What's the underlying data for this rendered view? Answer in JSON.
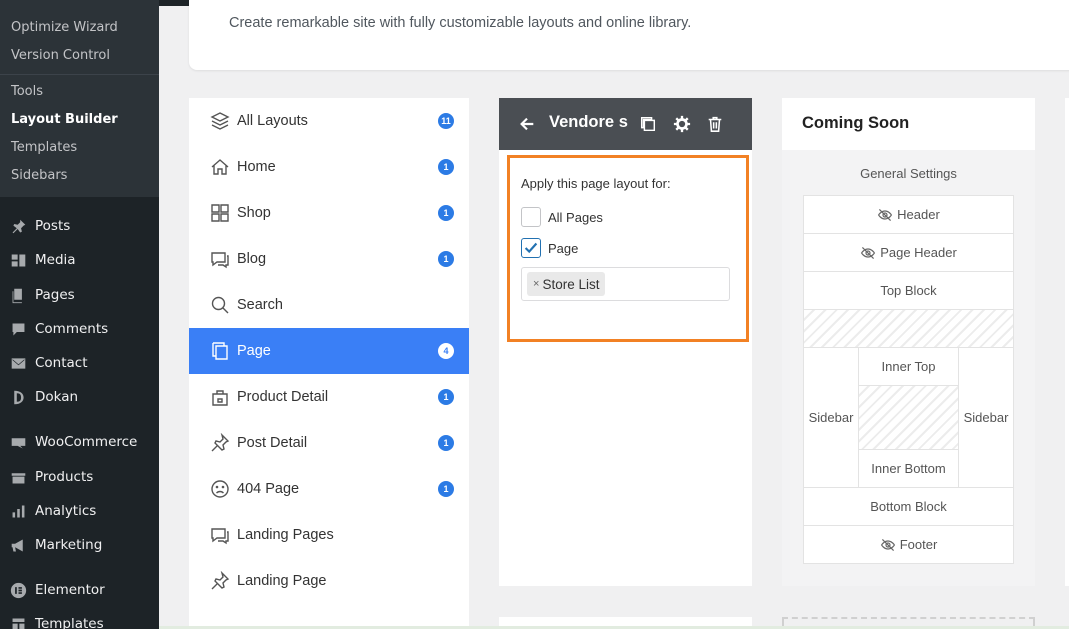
{
  "wp_sidebar": {
    "submenu": [
      "Optimize Wizard",
      "Version Control",
      "Tools",
      "Layout Builder",
      "Templates",
      "Sidebars"
    ],
    "current_sub": "Layout Builder",
    "menu": [
      {
        "label": "Posts",
        "icon": "pushpin-icon"
      },
      {
        "label": "Media",
        "icon": "media-icon"
      },
      {
        "label": "Pages",
        "icon": "pages-icon"
      },
      {
        "label": "Comments",
        "icon": "comments-icon"
      },
      {
        "label": "Contact",
        "icon": "mail-icon"
      },
      {
        "label": "Dokan",
        "icon": "dokan-icon"
      },
      {
        "label": "WooCommerce",
        "icon": "woocommerce-icon"
      },
      {
        "label": "Products",
        "icon": "products-icon"
      },
      {
        "label": "Analytics",
        "icon": "analytics-icon"
      },
      {
        "label": "Marketing",
        "icon": "megaphone-icon"
      },
      {
        "label": "Elementor",
        "icon": "elementor-icon"
      },
      {
        "label": "Templates",
        "icon": "templates-icon"
      }
    ]
  },
  "header": {
    "subtitle": "Create remarkable site with fully customizable layouts and online library."
  },
  "layouts": [
    {
      "label": "All Layouts",
      "icon": "layers-icon",
      "count": "11"
    },
    {
      "label": "Home",
      "icon": "home-icon",
      "count": "1"
    },
    {
      "label": "Shop",
      "icon": "grid-icon",
      "count": "1"
    },
    {
      "label": "Blog",
      "icon": "chat-icon",
      "count": "1"
    },
    {
      "label": "Search",
      "icon": "search-icon",
      "count": ""
    },
    {
      "label": "Page",
      "icon": "page-icon",
      "count": "4",
      "active": true
    },
    {
      "label": "Product Detail",
      "icon": "product-icon",
      "count": "1"
    },
    {
      "label": "Post Detail",
      "icon": "pin-icon",
      "count": "1"
    },
    {
      "label": "404 Page",
      "icon": "sad-face-icon",
      "count": "1"
    },
    {
      "label": "Landing Pages",
      "icon": "chat-icon",
      "count": ""
    },
    {
      "label": "Landing Page",
      "icon": "pin-icon",
      "count": ""
    }
  ],
  "editor": {
    "title": "Vendore s",
    "apply_label": "Apply this page layout for:",
    "options": [
      {
        "label": "All Pages",
        "checked": false
      },
      {
        "label": "Page",
        "checked": true
      }
    ],
    "tag": "Store List",
    "tag_remove": "×"
  },
  "coming_soon": {
    "title": "Coming Soon",
    "general_settings": "General Settings",
    "header": "Header",
    "page_header": "Page Header",
    "top_block": "Top Block",
    "sidebar_left": "Sidebar",
    "inner_top": "Inner Top",
    "inner_bottom": "Inner Bottom",
    "sidebar_right": "Sidebar",
    "bottom_block": "Bottom Block",
    "footer": "Footer"
  },
  "colors": {
    "accent": "#3a7ff6",
    "badge": "#2c7be5",
    "highlight_border": "#f28124",
    "wp_dark": "#1d2327"
  }
}
